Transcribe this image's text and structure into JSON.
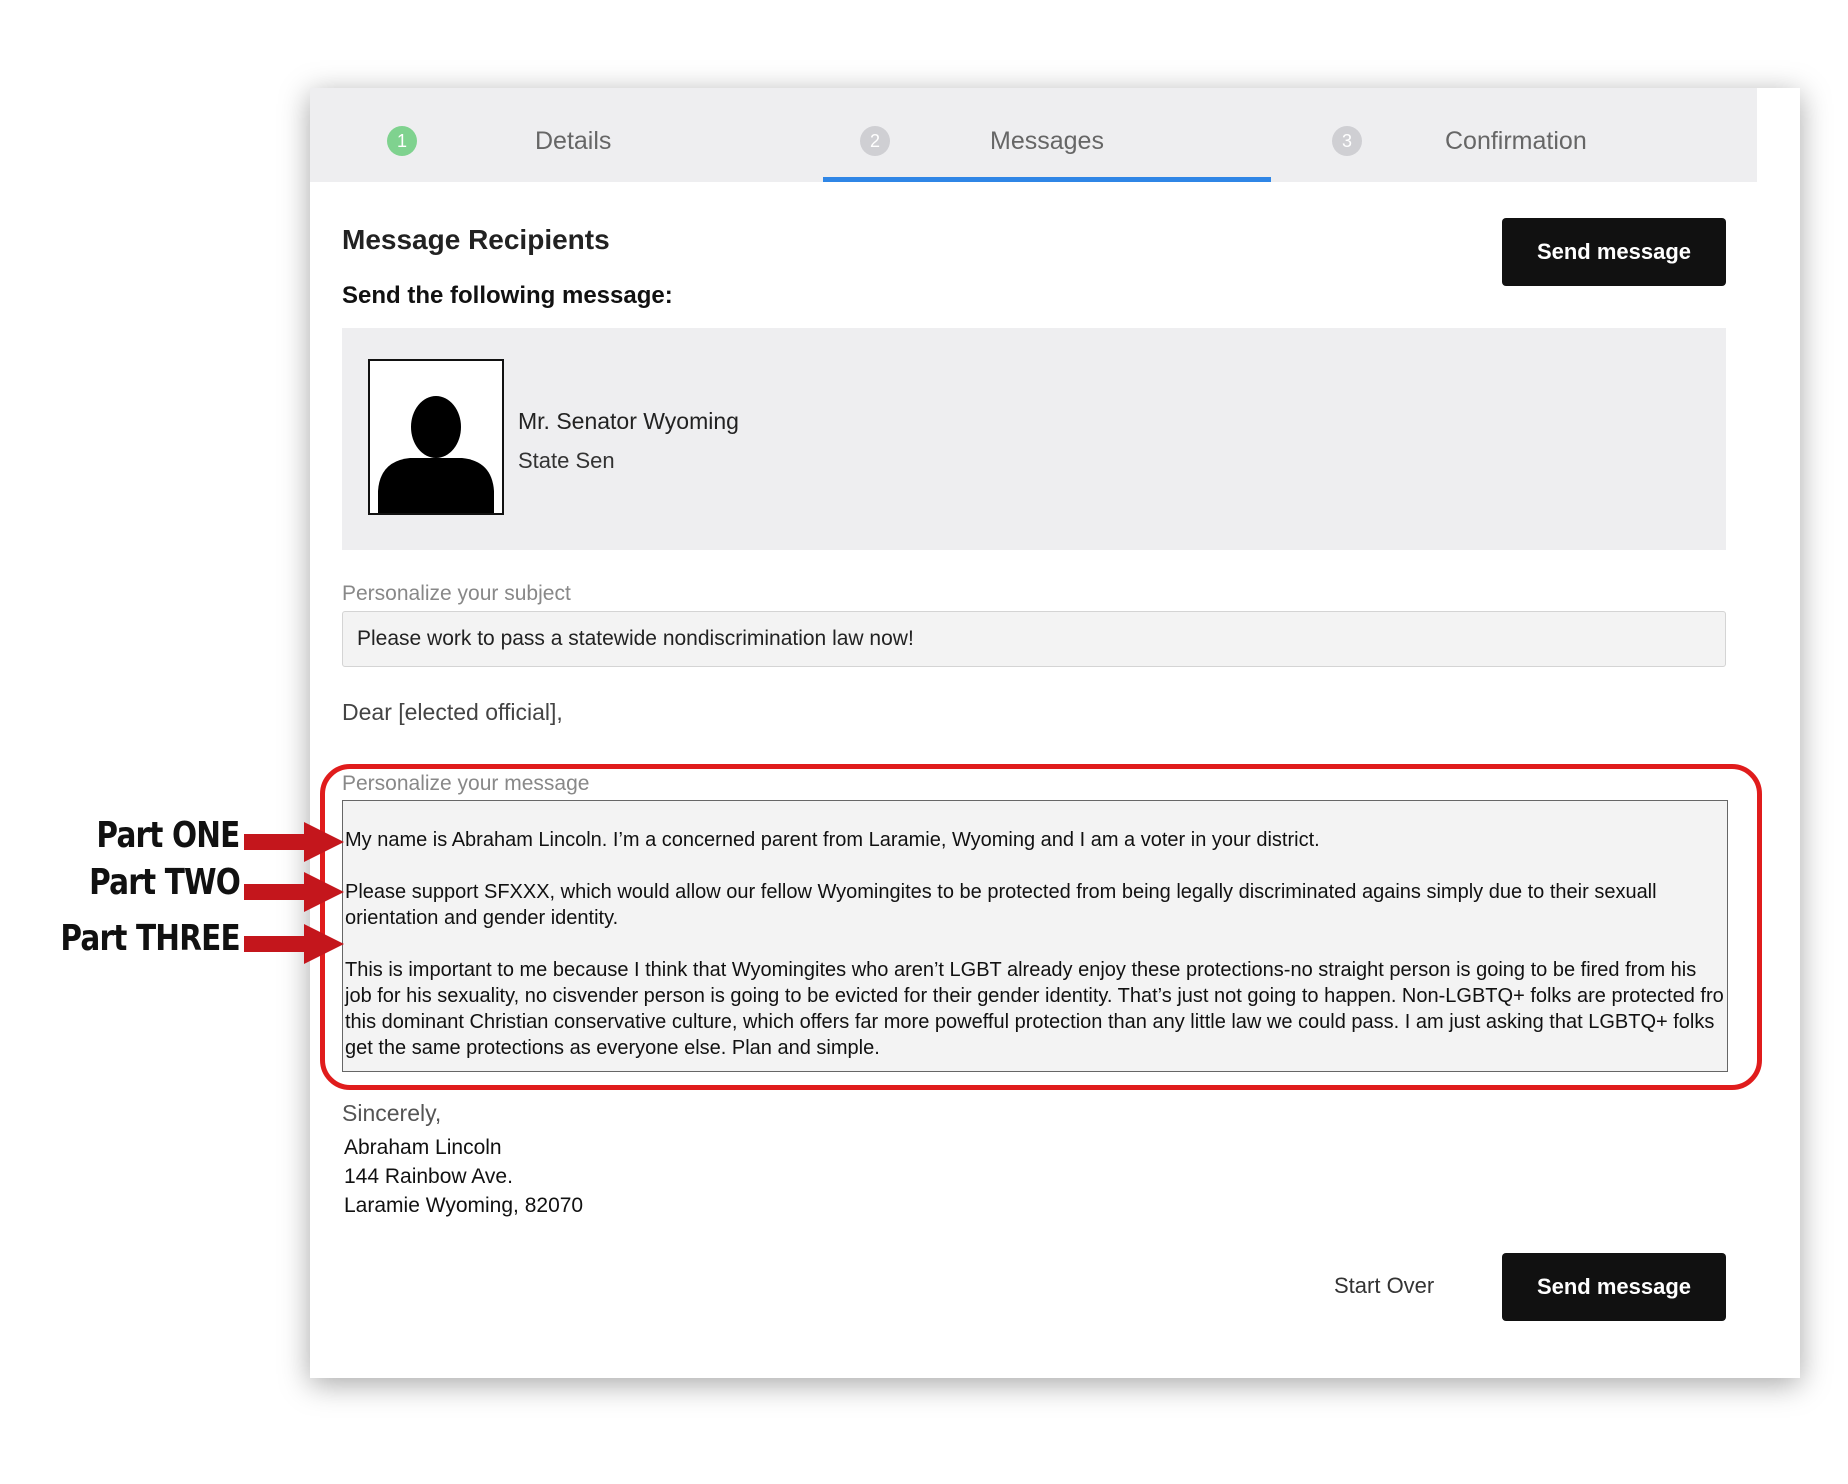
{
  "steps": [
    {
      "number": "1",
      "label": "Details"
    },
    {
      "number": "2",
      "label": "Messages"
    },
    {
      "number": "3",
      "label": "Confirmation"
    }
  ],
  "header": {
    "title": "Message Recipients",
    "subtitle": "Send the following message:",
    "send_label": "Send message"
  },
  "recipient": {
    "name": "Mr. Senator Wyoming",
    "title": "State Sen"
  },
  "subject": {
    "label": "Personalize your subject",
    "value": "Please work to pass a statewide nondiscrimination law now!"
  },
  "salutation": "Dear [elected official],",
  "message": {
    "label": "Personalize your message",
    "paragraphs": [
      "My name is Abraham Lincoln. I’m a concerned parent from Laramie, Wyoming and I am a voter in your district.",
      "Please support SFXXX, which would allow our fellow Wyomingites to be protected from being legally discriminated agains simply due to their sexuall orientation and gender identity.",
      "This is important to me because I think that Wyomingites who aren’t LGBT already enjoy these protections-no straight person is going to be fired from his job for his sexuality, no cisvender person is going to be evicted for their gender identity. That’s just not going to happen.  Non-LGBTQ+ folks are protected fro this dominant Christian conservative culture, which offers far more powefful protection than any little law we could pass. I am just asking that LGBTQ+ folks get the same protections as everyone else. Plan and simple."
    ]
  },
  "closing": "Sincerely,",
  "signature": {
    "name": "Abraham Lincoln",
    "address1": "144 Rainbow Ave.",
    "address2": "Laramie Wyoming, 82070"
  },
  "footer": {
    "start_over_label": "Start Over",
    "send_label": "Send message"
  },
  "annotations": [
    {
      "label": "Part ONE"
    },
    {
      "label": "Part TWO"
    },
    {
      "label": "Part THREE"
    }
  ],
  "colors": {
    "accent": "#2f86e6",
    "step_done": "#7fd28f",
    "step_pending": "#cfcfd3",
    "highlight": "#e01c1c",
    "button": "#111111"
  }
}
